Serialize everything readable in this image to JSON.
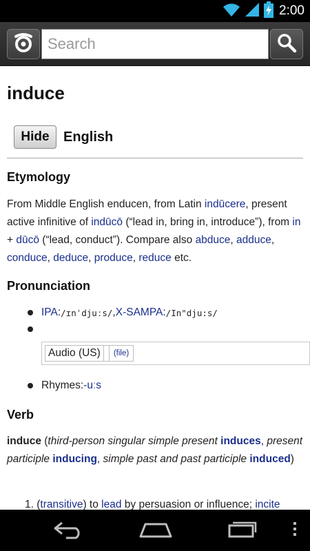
{
  "status_bar": {
    "time": "2:00"
  },
  "search": {
    "placeholder": "Search"
  },
  "page": {
    "title": "induce",
    "hide_label": "Hide",
    "language": "English"
  },
  "etymology": {
    "heading": "Etymology",
    "t1": "From Middle English enducen, from Latin ",
    "l1": "indūcere",
    "t2": ", present active infinitive of ",
    "l2": "indūcō",
    "t3": " (“lead in, bring in, introduce”), from ",
    "l3": "in",
    "t4": " + ",
    "l4": "dūcō",
    "t5": " (“lead, conduct”). Compare also ",
    "l5": "abduce",
    "s1": ", ",
    "l6": "adduce",
    "s2": ", ",
    "l7": "conduce",
    "s3": ", ",
    "l8": "deduce",
    "s4": ", ",
    "l9": "produce",
    "s5": ", ",
    "l10": "reduce",
    "t6": " etc."
  },
  "pronunciation": {
    "heading": "Pronunciation",
    "ipa_link": "IPA",
    "ipa_sep": ": ",
    "ipa_value": "/ɪnˈdjuːs/",
    "comma": ", ",
    "xsampa_link": "X-SAMPA",
    "xsampa_sep": ": ",
    "xsampa_value": "/In\"dju:s/",
    "audio_label": "Audio (US)",
    "audio_file": "(file)",
    "rhymes_label": "Rhymes: ",
    "rhymes_link": "-uːs"
  },
  "verb": {
    "heading": "Verb",
    "headword": "induce",
    "p1": " (",
    "i1": "third-person singular simple present",
    "p2": " ",
    "l1": "induces",
    "p3": ", ",
    "i2": "present participle",
    "p4": " ",
    "l2": "inducing",
    "p5": ", ",
    "i3": "simple past and past participle",
    "p6": " ",
    "l3": "induced",
    "p7": ")",
    "def_number": "1.",
    "def_paren_open": "(",
    "def_tag": "transitive",
    "def_paren_close": ")",
    "def_t1": " to ",
    "def_l1": "lead",
    "def_t2": " by persuasion or influence; ",
    "def_l2": "incite"
  },
  "colors": {
    "link": "#1a2f8c",
    "status_icon": "#33b5e5",
    "app_bar": "#303030"
  },
  "icons": {
    "wifi": "wifi-icon",
    "signal": "signal-icon",
    "battery": "battery-charging-icon",
    "logo": "app-logo-icon",
    "search": "search-icon",
    "back": "back-icon",
    "home": "home-icon",
    "recent": "recent-apps-icon",
    "menu": "overflow-menu-icon"
  }
}
